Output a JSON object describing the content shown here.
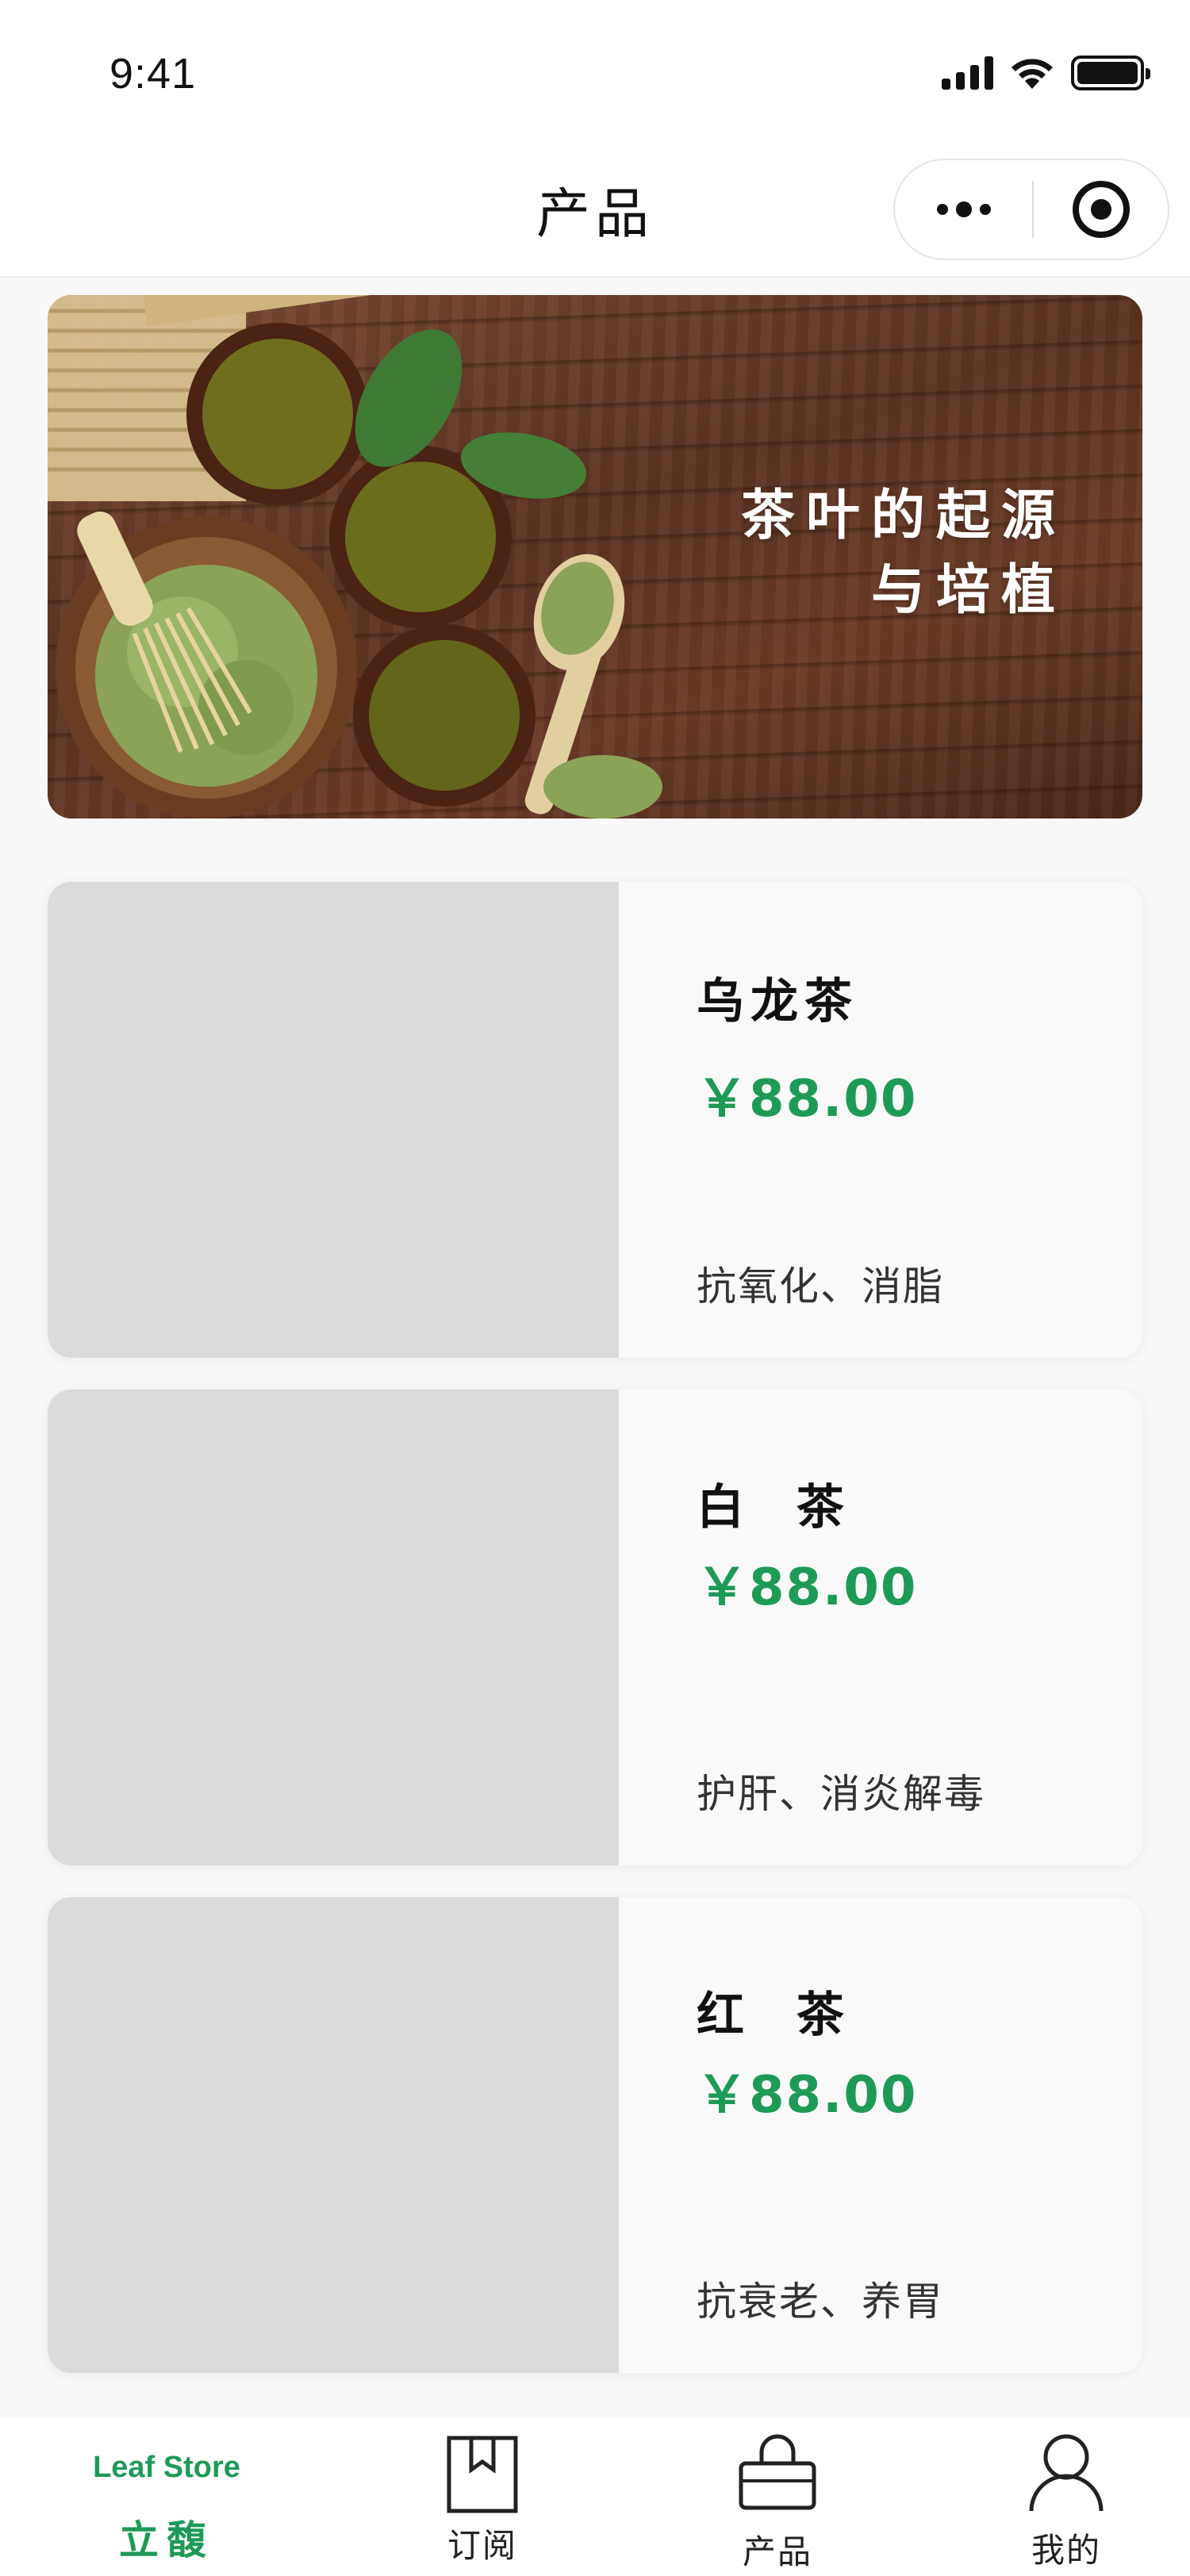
{
  "status_bar": {
    "time": "9:41"
  },
  "nav": {
    "title": "产品"
  },
  "banner": {
    "title": "茶叶的起源\n与培植"
  },
  "products": [
    {
      "name": "乌龙茶",
      "price": "￥88.00",
      "desc": "抗氧化、消脂"
    },
    {
      "name": "白  茶",
      "price": "￥88.00",
      "desc": "护肝、消炎解毒"
    },
    {
      "name": "红  茶",
      "price": "￥88.00",
      "desc": "抗衰老、养胃"
    }
  ],
  "tab_bar": {
    "brand": "Leaf Store",
    "brand_cn": "立馥",
    "tabs": [
      {
        "label": "订阅",
        "icon": "bookmark-icon"
      },
      {
        "label": "产品",
        "icon": "shopping-bag-icon"
      },
      {
        "label": "我的",
        "icon": "user-icon"
      }
    ]
  },
  "colors": {
    "accent": "#1e9a57",
    "placeholder": "#dbdbdb",
    "background": "#f8f8f8"
  }
}
